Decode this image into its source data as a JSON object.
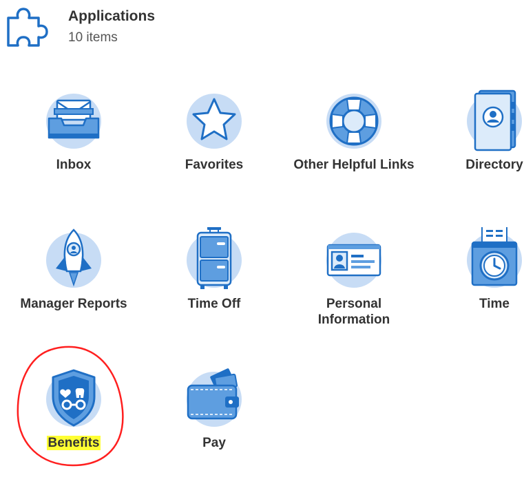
{
  "header": {
    "title": "Applications",
    "count_label": "10 items"
  },
  "apps": [
    {
      "id": "inbox",
      "label": "Inbox",
      "icon": "inbox-icon"
    },
    {
      "id": "favorites",
      "label": "Favorites",
      "icon": "star-icon"
    },
    {
      "id": "other-helpful-links",
      "label": "Other Helpful Links",
      "icon": "lifebuoy-icon"
    },
    {
      "id": "directory",
      "label": "Directory",
      "icon": "directory-book-icon"
    },
    {
      "id": "manager-reports",
      "label": "Manager Reports",
      "icon": "rocket-icon"
    },
    {
      "id": "time-off",
      "label": "Time Off",
      "icon": "suitcase-icon"
    },
    {
      "id": "personal-information",
      "label": "Personal Information",
      "icon": "id-card-icon"
    },
    {
      "id": "time",
      "label": "Time",
      "icon": "time-clock-icon"
    },
    {
      "id": "benefits",
      "label": "Benefits",
      "icon": "benefits-shield-icon"
    },
    {
      "id": "pay",
      "label": "Pay",
      "icon": "wallet-icon"
    }
  ],
  "colors": {
    "icon_circle": "#c7dcf5",
    "icon_blue": "#1f6fc5",
    "icon_mid": "#5e9ee0",
    "icon_light": "#dcebfa",
    "highlight": "#ffff33",
    "annotation_red": "#ff1f1f"
  }
}
